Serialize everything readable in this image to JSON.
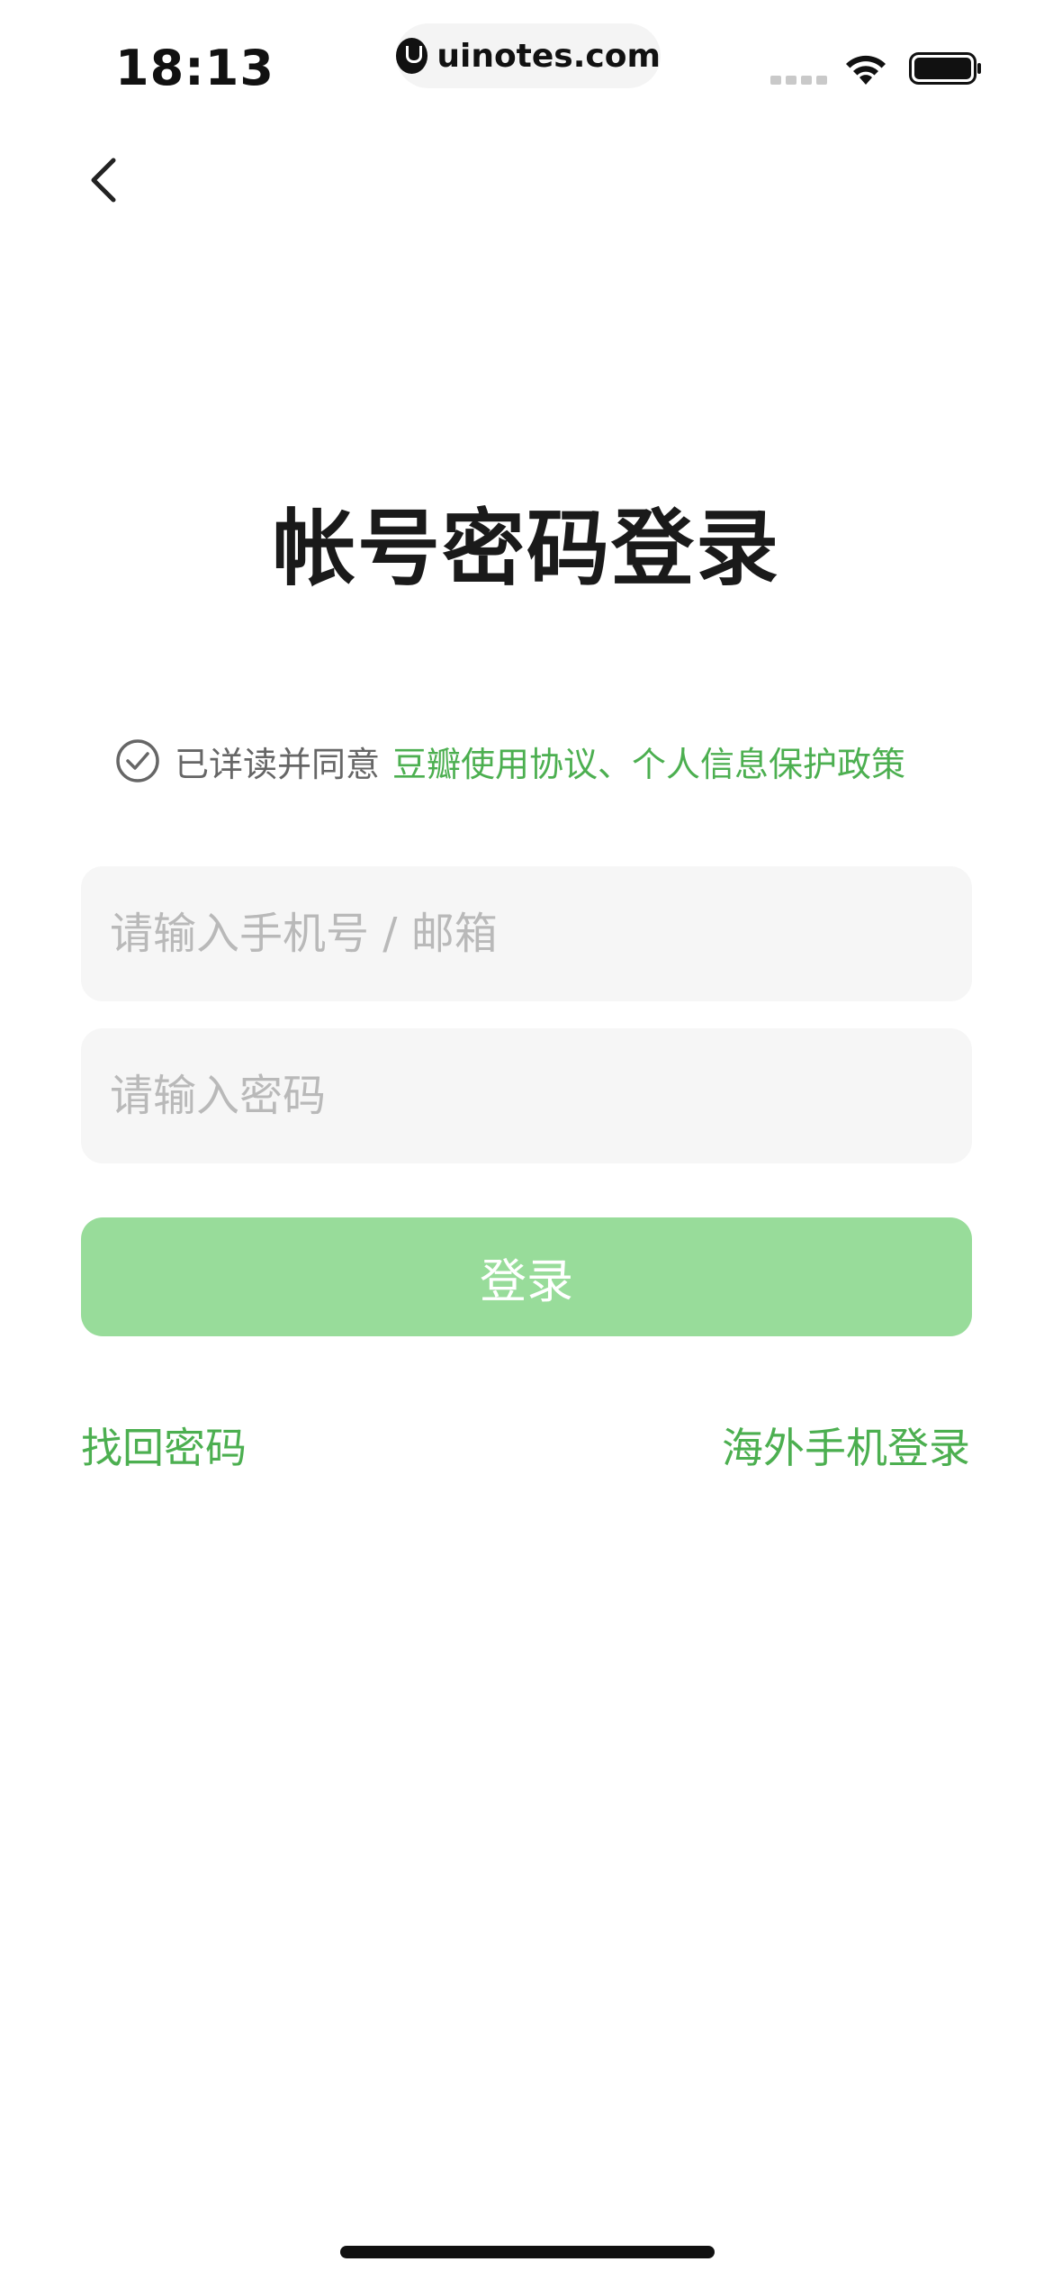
{
  "status_bar": {
    "time": "18:13",
    "url": "uinotes.com",
    "wifi_icon": "wifi-icon",
    "battery_icon": "battery-icon"
  },
  "nav": {
    "back_icon": "chevron-left-icon"
  },
  "title": "帐号密码登录",
  "agreement": {
    "check_icon": "check-circle-icon",
    "prefix": "已详读并同意",
    "link_terms": "豆瓣使用协议",
    "separator": "、",
    "link_privacy": "个人信息保护政策"
  },
  "form": {
    "account_placeholder": "请输入手机号 / 邮箱",
    "account_value": "",
    "password_placeholder": "请输入密码",
    "password_value": "",
    "login_label": "登录"
  },
  "links": {
    "forgot_password": "找回密码",
    "overseas_login": "海外手机登录"
  },
  "colors": {
    "accent": "#4caf50",
    "button_disabled": "#98dc9a",
    "input_bg": "#f6f6f6"
  }
}
